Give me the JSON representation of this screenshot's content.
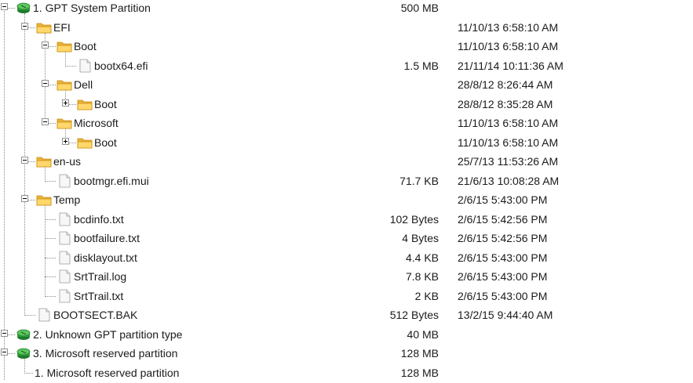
{
  "tree": {
    "rows": [
      {
        "label": "1. GPT System Partition",
        "size": "500 MB",
        "date": "",
        "type": "partition",
        "expand": "minus",
        "depth": 0
      },
      {
        "label": "EFI",
        "size": "",
        "date": "11/10/13 6:58:10 AM",
        "type": "folder",
        "expand": "minus",
        "depth": 1
      },
      {
        "label": "Boot",
        "size": "",
        "date": "11/10/13 6:58:10 AM",
        "type": "folder",
        "expand": "minus",
        "depth": 2
      },
      {
        "label": "bootx64.efi",
        "size": "1.5 MB",
        "date": "21/11/14 10:11:36 AM",
        "type": "file",
        "expand": "none",
        "depth": 3
      },
      {
        "label": "Dell",
        "size": "",
        "date": "28/8/12 8:26:44 AM",
        "type": "folder",
        "expand": "minus",
        "depth": 2
      },
      {
        "label": "Boot",
        "size": "",
        "date": "28/8/12 8:35:28 AM",
        "type": "folder",
        "expand": "plus",
        "depth": 3
      },
      {
        "label": "Microsoft",
        "size": "",
        "date": "11/10/13 6:58:10 AM",
        "type": "folder",
        "expand": "minus",
        "depth": 2
      },
      {
        "label": "Boot",
        "size": "",
        "date": "11/10/13 6:58:10 AM",
        "type": "folder",
        "expand": "plus",
        "depth": 3
      },
      {
        "label": "en-us",
        "size": "",
        "date": "25/7/13 11:53:26 AM",
        "type": "folder",
        "expand": "minus",
        "depth": 1
      },
      {
        "label": "bootmgr.efi.mui",
        "size": "71.7 KB",
        "date": "21/6/13 10:08:28 AM",
        "type": "file",
        "expand": "none",
        "depth": 2
      },
      {
        "label": "Temp",
        "size": "",
        "date": "2/6/15 5:43:00 PM",
        "type": "folder",
        "expand": "minus",
        "depth": 1
      },
      {
        "label": "bcdinfo.txt",
        "size": "102 Bytes",
        "date": "2/6/15 5:42:56 PM",
        "type": "file",
        "expand": "none",
        "depth": 2
      },
      {
        "label": "bootfailure.txt",
        "size": "4 Bytes",
        "date": "2/6/15 5:42:56 PM",
        "type": "file",
        "expand": "none",
        "depth": 2
      },
      {
        "label": "disklayout.txt",
        "size": "4.4 KB",
        "date": "2/6/15 5:43:00 PM",
        "type": "file",
        "expand": "none",
        "depth": 2
      },
      {
        "label": "SrtTrail.log",
        "size": "7.8 KB",
        "date": "2/6/15 5:43:00 PM",
        "type": "file",
        "expand": "none",
        "depth": 2
      },
      {
        "label": "SrtTrail.txt",
        "size": "2 KB",
        "date": "2/6/15 5:43:00 PM",
        "type": "file",
        "expand": "none",
        "depth": 2
      },
      {
        "label": "BOOTSECT.BAK",
        "size": "512 Bytes",
        "date": "13/2/15 9:44:40 AM",
        "type": "file",
        "expand": "none",
        "depth": 1
      },
      {
        "label": "2. Unknown GPT partition type",
        "size": "40 MB",
        "date": "",
        "type": "partition",
        "expand": "minus",
        "depth": 0
      },
      {
        "label": "3. Microsoft reserved partition",
        "size": "128 MB",
        "date": "",
        "type": "partition",
        "expand": "minus",
        "depth": 0
      },
      {
        "label": "1. Microsoft reserved partition",
        "size": "128 MB",
        "date": "",
        "type": "text",
        "expand": "none",
        "depth": 1
      }
    ]
  }
}
